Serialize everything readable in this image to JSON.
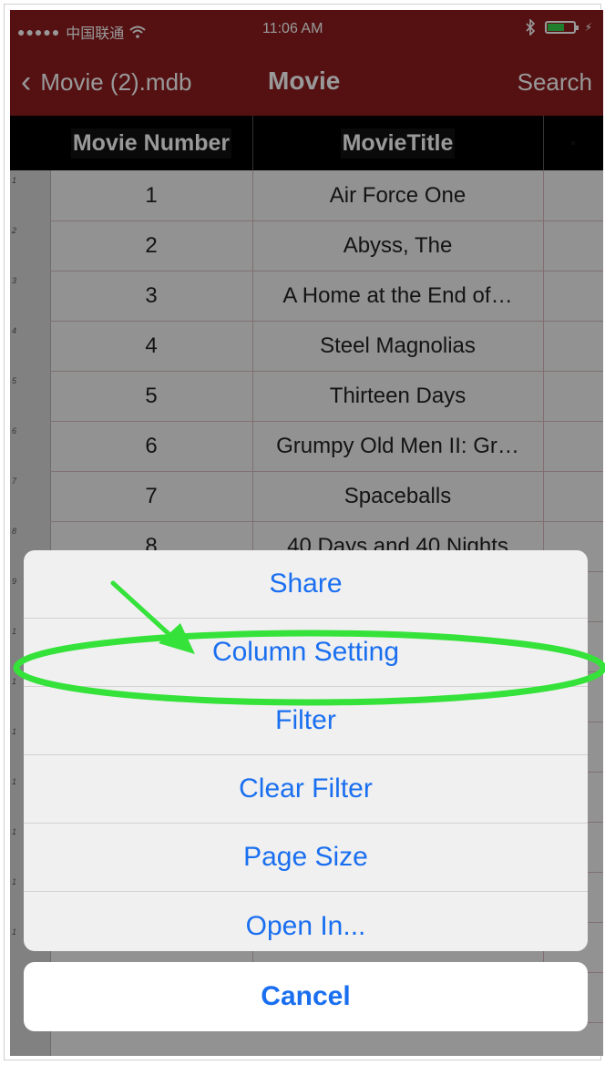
{
  "status_bar": {
    "signal": "●●●●●",
    "carrier": "中国联通",
    "time": "11:06 AM",
    "bluetooth": "bluetooth-icon",
    "battery_color": "#36d14c"
  },
  "nav": {
    "back_label": "Movie (2).mdb",
    "title": "Movie",
    "search_label": "Search"
  },
  "table": {
    "columns": [
      "Movie Number",
      "MovieTitle",
      ""
    ],
    "rows": [
      {
        "num": "1",
        "title": "Air Force One"
      },
      {
        "num": "2",
        "title": "Abyss, The"
      },
      {
        "num": "3",
        "title": "A Home at the End of…"
      },
      {
        "num": "4",
        "title": "Steel Magnolias"
      },
      {
        "num": "5",
        "title": "Thirteen Days"
      },
      {
        "num": "6",
        "title": "Grumpy Old Men II: Gr…"
      },
      {
        "num": "7",
        "title": "Spaceballs"
      },
      {
        "num": "8",
        "title": "40 Days and 40 Nights"
      }
    ],
    "row_numbers": [
      "1",
      "2",
      "3",
      "4",
      "5",
      "6",
      "7",
      "8",
      "9",
      "1",
      "1",
      "1",
      "1",
      "1",
      "1",
      "1"
    ]
  },
  "action_sheet": {
    "items": [
      "Share",
      "Column Setting",
      "Filter",
      "Clear Filter",
      "Page Size",
      "Open In..."
    ],
    "cancel_label": "Cancel"
  },
  "colors": {
    "nav_background": "#8e1d1f",
    "action_blue": "#1a6ff0",
    "highlight_green": "#35e23a"
  }
}
